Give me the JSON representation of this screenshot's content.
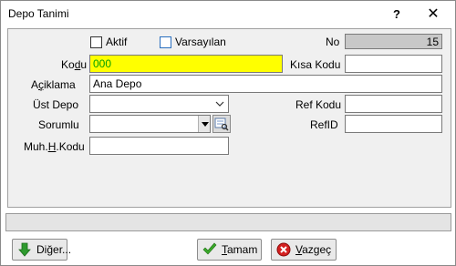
{
  "window": {
    "title": "Depo Tanimi",
    "help_glyph": "?",
    "close_glyph": "✕"
  },
  "form": {
    "aktif_label": "Aktif",
    "varsayilan_label": "Varsayılan",
    "no_label": "No",
    "no_value": "15",
    "kodu_label_a": "Ko",
    "kodu_label_u": "d",
    "kodu_label_b": "u",
    "kodu_value": "000",
    "kisa_kodu_label": "Kısa Kodu",
    "kisa_kodu_value": "",
    "aciklama_label_a": "A",
    "aciklama_label_u": "ç",
    "aciklama_label_b": "iklama",
    "aciklama_value": "Ana Depo",
    "ust_depo_label": "Üst Depo",
    "ust_depo_value": "",
    "ref_kodu_label": "Ref Kodu",
    "ref_kodu_value": "",
    "sorumlu_label": "Sorumlu",
    "sorumlu_value": "",
    "refid_label": "RefID",
    "refid_value": "",
    "muh_label_a": "Muh.",
    "muh_label_u": "H",
    "muh_label_b": ".Kodu",
    "muh_value": ""
  },
  "buttons": {
    "diger_a": "Di",
    "diger_u": "ğ",
    "diger_b": "er...",
    "tamam_a": "",
    "tamam_u": "T",
    "tamam_b": "amam",
    "vazgec_a": "",
    "vazgec_u": "V",
    "vazgec_b": "azgeç"
  },
  "icons": {
    "help": "help-icon",
    "close": "close-icon",
    "dropdown": "chevron-down-icon",
    "lookup": "lookup-icon",
    "down_arrow": "green-down-arrow-icon",
    "check": "green-check-icon",
    "cancel": "red-x-icon"
  }
}
